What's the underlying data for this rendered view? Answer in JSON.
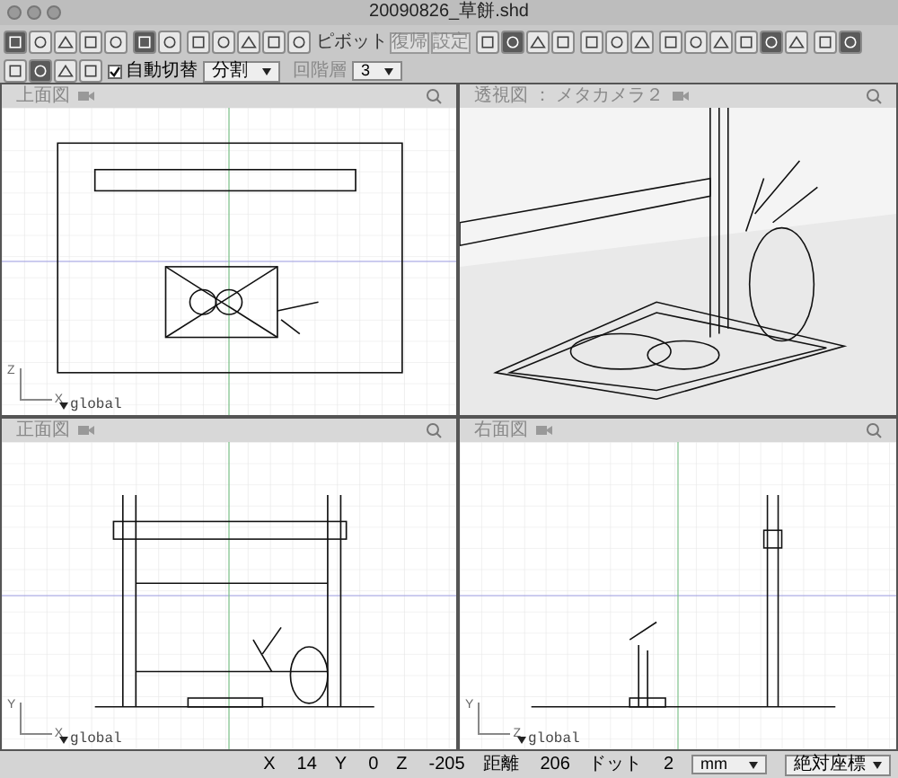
{
  "window": {
    "title": "20090826_草餅.shd"
  },
  "toolbar": {
    "groups": [
      [
        {
          "selected": true
        },
        {
          "selected": false
        },
        {
          "selected": false
        },
        {
          "selected": false
        },
        {
          "selected": false
        }
      ],
      [
        {
          "selected": true
        },
        {
          "selected": false
        }
      ],
      [
        {
          "selected": false
        },
        {
          "selected": false
        },
        {
          "selected": false
        },
        {
          "selected": false
        },
        {
          "selected": false
        }
      ]
    ],
    "pivot": {
      "label": "ピボット",
      "buttons": [
        "復帰",
        "設定"
      ],
      "level_label": "回階層",
      "level_value": "3"
    },
    "groups_right": [
      [
        {
          "selected": false
        },
        {
          "selected": true
        },
        {
          "selected": false
        },
        {
          "selected": false
        }
      ],
      [
        {
          "selected": false
        },
        {
          "selected": false
        },
        {
          "selected": false
        }
      ],
      [
        {
          "selected": false
        },
        {
          "selected": false
        },
        {
          "selected": false
        },
        {
          "selected": false
        },
        {
          "selected": true
        },
        {
          "selected": false
        }
      ],
      [
        {
          "selected": false
        },
        {
          "selected": true
        }
      ]
    ]
  },
  "toolbar2": {
    "buttons": [
      {
        "selected": false
      },
      {
        "selected": true
      },
      {
        "selected": false
      },
      {
        "selected": false
      }
    ],
    "auto_switch": {
      "label": "自動切替",
      "checked": true
    },
    "split": {
      "value": "分割"
    }
  },
  "views": [
    {
      "kind": "top",
      "label": "上面図",
      "axis_labels": [
        "Z",
        "X"
      ],
      "origin": "global"
    },
    {
      "kind": "perspective",
      "label": "透視図 ： メタカメラ２"
    },
    {
      "kind": "front",
      "label": "正面図",
      "axis_labels": [
        "Y",
        "X"
      ],
      "origin": "global"
    },
    {
      "kind": "right",
      "label": "右面図",
      "axis_labels": [
        "Y",
        "Z"
      ],
      "origin": "global"
    }
  ],
  "status_bar": {
    "fields": [
      {
        "label": "X",
        "value": "14"
      },
      {
        "label": "Y",
        "value": "0"
      },
      {
        "label": "Z",
        "value": "-205"
      },
      {
        "label": "距離",
        "value": "206"
      },
      {
        "label": "ドット",
        "value": "2"
      }
    ],
    "unit": "mm",
    "coords": "絶対座標"
  }
}
